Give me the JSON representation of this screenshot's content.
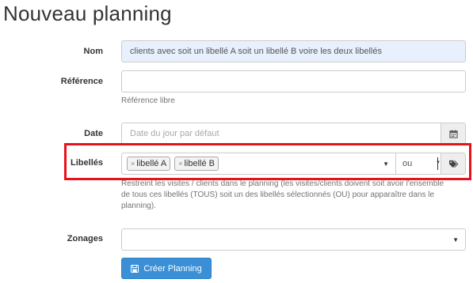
{
  "page": {
    "title": "Nouveau planning"
  },
  "form": {
    "nom": {
      "label": "Nom",
      "value": "clients avec soit un libellé A soit un libellé B voire les deux libellés"
    },
    "reference": {
      "label": "Référence",
      "value": "",
      "help": "Référence libre"
    },
    "date": {
      "label": "Date",
      "placeholder": "Date du jour par défaut",
      "icon": "calendar-icon"
    },
    "libelles": {
      "label": "Libellés",
      "tags": [
        {
          "remove": "×",
          "label": "libellé A"
        },
        {
          "remove": "×",
          "label": "libellé B"
        }
      ],
      "operator": "ou",
      "tag_icon": "tags-icon",
      "help_line1": "Restreint les visites / clients dans le planning (les visites/clients doivent soit avoir l'ensemble",
      "help_line2": "de tous ces libellés (TOUS) soit un des libellés sélectionnés (OU) pour apparaître dans le",
      "help_line3": "planning)."
    },
    "zonages": {
      "label": "Zonages",
      "value": ""
    },
    "submit": {
      "label": "Créer Planning",
      "icon": "save-icon"
    }
  },
  "colors": {
    "primary": "#3a8fd7",
    "highlight": "#e8121a",
    "autofill": "#e8f0fe"
  }
}
